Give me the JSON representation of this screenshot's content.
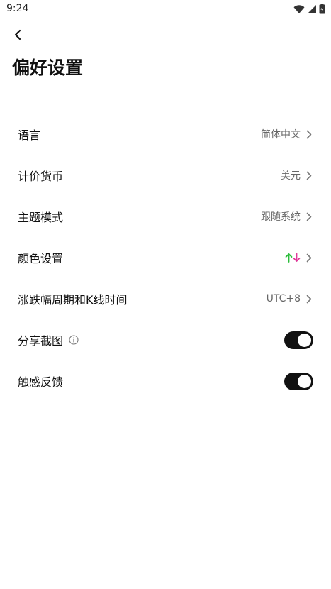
{
  "status_bar": {
    "time": "9:24"
  },
  "header": {
    "title": "偏好设置"
  },
  "settings": {
    "language": {
      "label": "语言",
      "value": "简体中文"
    },
    "currency": {
      "label": "计价货币",
      "value": "美元"
    },
    "theme": {
      "label": "主题模式",
      "value": "跟随系统"
    },
    "color": {
      "label": "颜色设置",
      "up_color": "#2bbd3b",
      "down_color": "#e0399a"
    },
    "change_period": {
      "label": "涨跌幅周期和K线时间",
      "value": "UTC+8"
    },
    "share_screenshot": {
      "label": "分享截图",
      "enabled": true
    },
    "haptic_feedback": {
      "label": "触感反馈",
      "enabled": true
    }
  },
  "icons": [
    "wifi-icon",
    "signal-icon",
    "battery-icon",
    "back-arrow-icon",
    "chevron-right-icon",
    "info-icon",
    "arrow-up-icon",
    "arrow-down-icon"
  ]
}
